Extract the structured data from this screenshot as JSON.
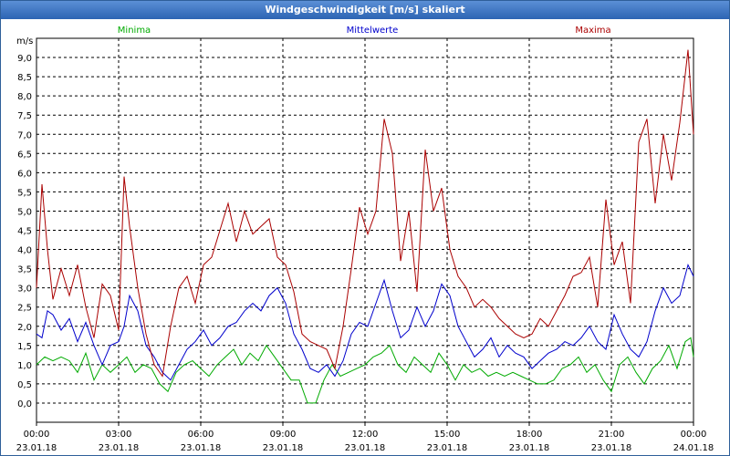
{
  "window": {
    "title": "Windgeschwindigkeit [m/s] skaliert"
  },
  "chart_data": {
    "type": "line",
    "title": "Windgeschwindigkeit [m/s] skaliert",
    "ylabel": "m/s",
    "ylim": [
      -0.5,
      9.5
    ],
    "y_ticks": [
      "9,0",
      "8,5",
      "8,0",
      "7,5",
      "7,0",
      "6,5",
      "6,0",
      "5,5",
      "5,0",
      "4,5",
      "4,0",
      "3,5",
      "3,0",
      "2,5",
      "2,0",
      "1,5",
      "1,0",
      "0,5",
      "0,0"
    ],
    "x_ticks": [
      {
        "time": "00:00",
        "date": "23.01.18"
      },
      {
        "time": "03:00",
        "date": "23.01.18"
      },
      {
        "time": "06:00",
        "date": "23.01.18"
      },
      {
        "time": "09:00",
        "date": "23.01.18"
      },
      {
        "time": "12:00",
        "date": "23.01.18"
      },
      {
        "time": "15:00",
        "date": "23.01.18"
      },
      {
        "time": "18:00",
        "date": "23.01.18"
      },
      {
        "time": "21:00",
        "date": "23.01.18"
      },
      {
        "time": "00:00",
        "date": "24.01.18"
      }
    ],
    "x_range_hours": [
      0,
      24
    ],
    "grid": true,
    "legend_position": "top",
    "series": [
      {
        "name": "Minima",
        "color": "#00aa00",
        "points": [
          [
            0,
            1.0
          ],
          [
            0.3,
            1.2
          ],
          [
            0.6,
            1.1
          ],
          [
            0.9,
            1.2
          ],
          [
            1.2,
            1.1
          ],
          [
            1.5,
            0.8
          ],
          [
            1.8,
            1.3
          ],
          [
            2.1,
            0.6
          ],
          [
            2.4,
            1.0
          ],
          [
            2.7,
            0.8
          ],
          [
            3.0,
            1.0
          ],
          [
            3.3,
            1.2
          ],
          [
            3.6,
            0.8
          ],
          [
            3.9,
            1.0
          ],
          [
            4.2,
            0.9
          ],
          [
            4.5,
            0.5
          ],
          [
            4.8,
            0.3
          ],
          [
            5.1,
            0.8
          ],
          [
            5.4,
            1.0
          ],
          [
            5.7,
            1.1
          ],
          [
            6.0,
            0.9
          ],
          [
            6.3,
            0.7
          ],
          [
            6.6,
            1.0
          ],
          [
            6.9,
            1.2
          ],
          [
            7.2,
            1.4
          ],
          [
            7.5,
            1.0
          ],
          [
            7.8,
            1.3
          ],
          [
            8.1,
            1.1
          ],
          [
            8.4,
            1.5
          ],
          [
            8.7,
            1.2
          ],
          [
            9.0,
            0.9
          ],
          [
            9.3,
            0.6
          ],
          [
            9.6,
            0.6
          ],
          [
            9.9,
            0.0
          ],
          [
            10.2,
            0.0
          ],
          [
            10.5,
            0.6
          ],
          [
            10.8,
            1.0
          ],
          [
            11.1,
            0.7
          ],
          [
            11.4,
            0.8
          ],
          [
            11.7,
            0.9
          ],
          [
            12.0,
            1.0
          ],
          [
            12.3,
            1.2
          ],
          [
            12.6,
            1.3
          ],
          [
            12.9,
            1.5
          ],
          [
            13.2,
            1.0
          ],
          [
            13.5,
            0.8
          ],
          [
            13.8,
            1.2
          ],
          [
            14.1,
            1.0
          ],
          [
            14.4,
            0.8
          ],
          [
            14.7,
            1.3
          ],
          [
            15.0,
            1.0
          ],
          [
            15.3,
            0.6
          ],
          [
            15.6,
            1.0
          ],
          [
            15.9,
            0.8
          ],
          [
            16.2,
            0.9
          ],
          [
            16.5,
            0.7
          ],
          [
            16.8,
            0.8
          ],
          [
            17.1,
            0.7
          ],
          [
            17.4,
            0.8
          ],
          [
            17.7,
            0.7
          ],
          [
            18.0,
            0.6
          ],
          [
            18.3,
            0.5
          ],
          [
            18.6,
            0.5
          ],
          [
            18.9,
            0.6
          ],
          [
            19.2,
            0.9
          ],
          [
            19.5,
            1.0
          ],
          [
            19.8,
            1.2
          ],
          [
            20.1,
            0.8
          ],
          [
            20.4,
            1.0
          ],
          [
            20.7,
            0.6
          ],
          [
            21.0,
            0.3
          ],
          [
            21.3,
            1.0
          ],
          [
            21.6,
            1.2
          ],
          [
            21.9,
            0.8
          ],
          [
            22.2,
            0.5
          ],
          [
            22.5,
            0.9
          ],
          [
            22.8,
            1.1
          ],
          [
            23.1,
            1.5
          ],
          [
            23.4,
            0.9
          ],
          [
            23.7,
            1.6
          ],
          [
            23.9,
            1.7
          ],
          [
            24.0,
            1.2
          ]
        ]
      },
      {
        "name": "Mittelwerte",
        "color": "#0000cc",
        "points": [
          [
            0,
            1.8
          ],
          [
            0.2,
            1.7
          ],
          [
            0.4,
            2.4
          ],
          [
            0.6,
            2.3
          ],
          [
            0.9,
            1.9
          ],
          [
            1.2,
            2.2
          ],
          [
            1.5,
            1.6
          ],
          [
            1.8,
            2.1
          ],
          [
            2.1,
            1.5
          ],
          [
            2.4,
            1.0
          ],
          [
            2.7,
            1.5
          ],
          [
            3.0,
            1.6
          ],
          [
            3.2,
            2.0
          ],
          [
            3.4,
            2.8
          ],
          [
            3.7,
            2.4
          ],
          [
            4.0,
            1.5
          ],
          [
            4.3,
            1.2
          ],
          [
            4.6,
            0.8
          ],
          [
            4.9,
            0.6
          ],
          [
            5.2,
            1.0
          ],
          [
            5.5,
            1.4
          ],
          [
            5.8,
            1.6
          ],
          [
            6.1,
            1.9
          ],
          [
            6.4,
            1.5
          ],
          [
            6.7,
            1.7
          ],
          [
            7.0,
            2.0
          ],
          [
            7.3,
            2.1
          ],
          [
            7.6,
            2.4
          ],
          [
            7.9,
            2.6
          ],
          [
            8.2,
            2.4
          ],
          [
            8.5,
            2.8
          ],
          [
            8.8,
            3.0
          ],
          [
            9.1,
            2.6
          ],
          [
            9.4,
            1.8
          ],
          [
            9.7,
            1.4
          ],
          [
            10.0,
            0.9
          ],
          [
            10.3,
            0.8
          ],
          [
            10.6,
            1.0
          ],
          [
            10.9,
            0.7
          ],
          [
            11.2,
            1.1
          ],
          [
            11.5,
            1.8
          ],
          [
            11.8,
            2.1
          ],
          [
            12.1,
            2.0
          ],
          [
            12.4,
            2.6
          ],
          [
            12.7,
            3.2
          ],
          [
            13.0,
            2.4
          ],
          [
            13.3,
            1.7
          ],
          [
            13.6,
            1.9
          ],
          [
            13.9,
            2.5
          ],
          [
            14.2,
            2.0
          ],
          [
            14.5,
            2.4
          ],
          [
            14.8,
            3.1
          ],
          [
            15.1,
            2.8
          ],
          [
            15.4,
            2.0
          ],
          [
            15.7,
            1.6
          ],
          [
            16.0,
            1.2
          ],
          [
            16.3,
            1.4
          ],
          [
            16.6,
            1.7
          ],
          [
            16.9,
            1.2
          ],
          [
            17.2,
            1.5
          ],
          [
            17.5,
            1.3
          ],
          [
            17.8,
            1.2
          ],
          [
            18.1,
            0.9
          ],
          [
            18.4,
            1.1
          ],
          [
            18.7,
            1.3
          ],
          [
            19.0,
            1.4
          ],
          [
            19.3,
            1.6
          ],
          [
            19.6,
            1.5
          ],
          [
            19.9,
            1.7
          ],
          [
            20.2,
            2.0
          ],
          [
            20.5,
            1.6
          ],
          [
            20.8,
            1.4
          ],
          [
            21.1,
            2.3
          ],
          [
            21.4,
            1.8
          ],
          [
            21.7,
            1.4
          ],
          [
            22.0,
            1.2
          ],
          [
            22.3,
            1.6
          ],
          [
            22.6,
            2.4
          ],
          [
            22.9,
            3.0
          ],
          [
            23.2,
            2.6
          ],
          [
            23.5,
            2.8
          ],
          [
            23.8,
            3.6
          ],
          [
            24.0,
            3.3
          ]
        ]
      },
      {
        "name": "Maxima",
        "color": "#aa0000",
        "points": [
          [
            0,
            3.0
          ],
          [
            0.2,
            5.7
          ],
          [
            0.4,
            4.0
          ],
          [
            0.6,
            2.7
          ],
          [
            0.9,
            3.5
          ],
          [
            1.2,
            2.8
          ],
          [
            1.5,
            3.6
          ],
          [
            1.8,
            2.5
          ],
          [
            2.1,
            1.7
          ],
          [
            2.4,
            3.1
          ],
          [
            2.7,
            2.8
          ],
          [
            3.0,
            1.9
          ],
          [
            3.2,
            5.9
          ],
          [
            3.4,
            4.6
          ],
          [
            3.7,
            3.0
          ],
          [
            4.0,
            1.8
          ],
          [
            4.3,
            1.0
          ],
          [
            4.6,
            0.7
          ],
          [
            4.9,
            2.0
          ],
          [
            5.2,
            3.0
          ],
          [
            5.5,
            3.3
          ],
          [
            5.8,
            2.6
          ],
          [
            6.1,
            3.6
          ],
          [
            6.4,
            3.8
          ],
          [
            6.7,
            4.5
          ],
          [
            7.0,
            5.2
          ],
          [
            7.3,
            4.2
          ],
          [
            7.6,
            5.0
          ],
          [
            7.9,
            4.4
          ],
          [
            8.2,
            4.6
          ],
          [
            8.5,
            4.8
          ],
          [
            8.8,
            3.8
          ],
          [
            9.1,
            3.6
          ],
          [
            9.4,
            2.9
          ],
          [
            9.7,
            1.8
          ],
          [
            10.0,
            1.6
          ],
          [
            10.3,
            1.5
          ],
          [
            10.6,
            1.4
          ],
          [
            10.9,
            0.9
          ],
          [
            11.2,
            2.0
          ],
          [
            11.5,
            3.5
          ],
          [
            11.8,
            5.1
          ],
          [
            12.1,
            4.4
          ],
          [
            12.4,
            5.0
          ],
          [
            12.7,
            7.4
          ],
          [
            13.0,
            6.5
          ],
          [
            13.3,
            3.7
          ],
          [
            13.6,
            5.0
          ],
          [
            13.9,
            2.9
          ],
          [
            14.2,
            6.6
          ],
          [
            14.5,
            5.0
          ],
          [
            14.8,
            5.6
          ],
          [
            15.1,
            4.0
          ],
          [
            15.4,
            3.3
          ],
          [
            15.7,
            3.0
          ],
          [
            16.0,
            2.5
          ],
          [
            16.3,
            2.7
          ],
          [
            16.6,
            2.5
          ],
          [
            16.9,
            2.2
          ],
          [
            17.2,
            2.0
          ],
          [
            17.5,
            1.8
          ],
          [
            17.8,
            1.7
          ],
          [
            18.1,
            1.8
          ],
          [
            18.4,
            2.2
          ],
          [
            18.7,
            2.0
          ],
          [
            19.0,
            2.4
          ],
          [
            19.3,
            2.8
          ],
          [
            19.6,
            3.3
          ],
          [
            19.9,
            3.4
          ],
          [
            20.2,
            3.8
          ],
          [
            20.5,
            2.5
          ],
          [
            20.8,
            5.3
          ],
          [
            21.1,
            3.6
          ],
          [
            21.4,
            4.2
          ],
          [
            21.7,
            2.6
          ],
          [
            22.0,
            6.8
          ],
          [
            22.3,
            7.4
          ],
          [
            22.6,
            5.2
          ],
          [
            22.9,
            7.0
          ],
          [
            23.2,
            5.8
          ],
          [
            23.5,
            7.3
          ],
          [
            23.8,
            9.2
          ],
          [
            24.0,
            7.0
          ]
        ]
      }
    ]
  }
}
